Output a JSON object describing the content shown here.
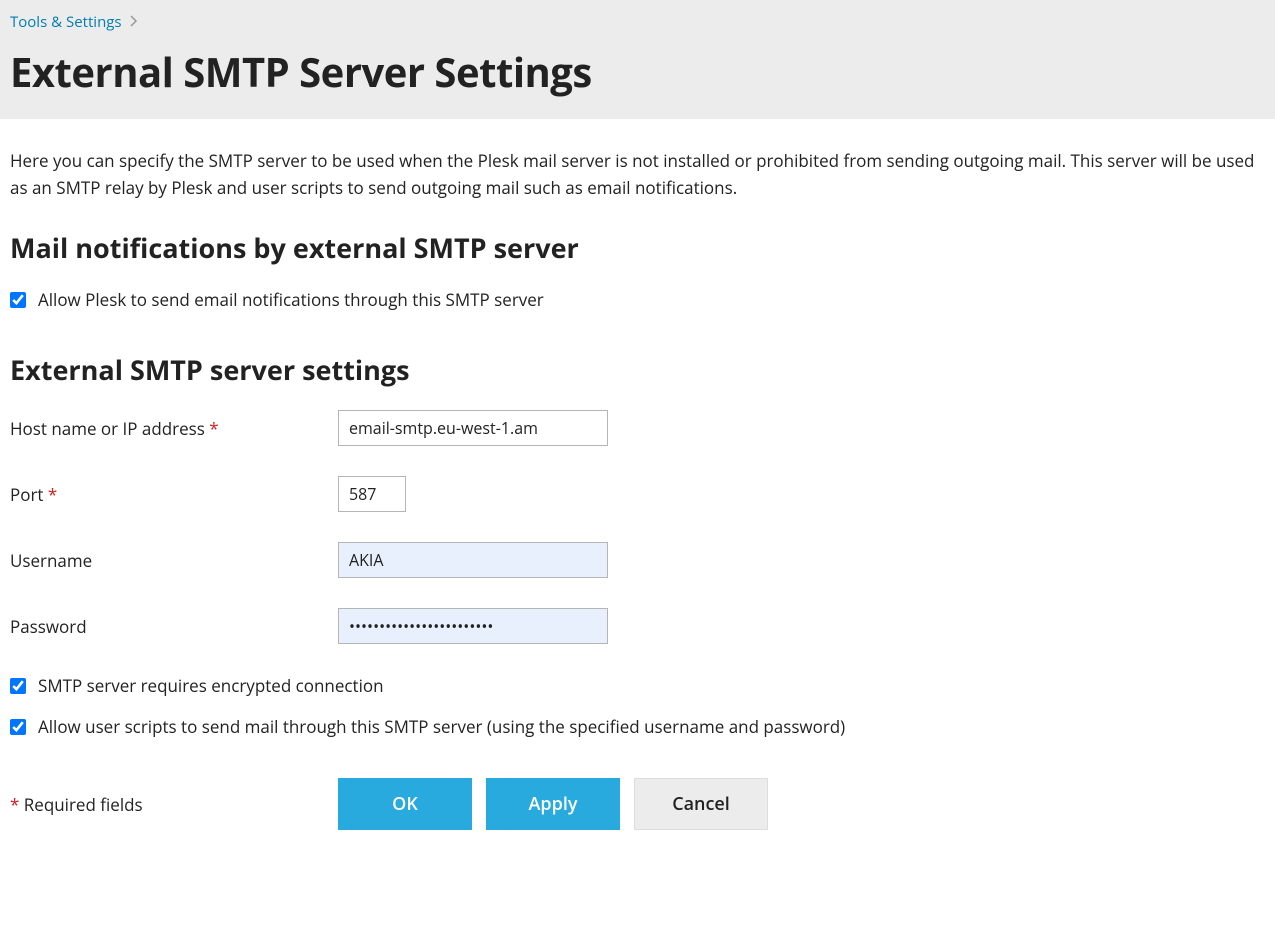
{
  "breadcrumb": {
    "link": "Tools & Settings"
  },
  "page": {
    "title": "External SMTP Server Settings",
    "description": "Here you can specify the SMTP server to be used when the Plesk mail server is not installed or prohibited from sending outgoing mail. This server will be used as an SMTP relay by Plesk and user scripts to send outgoing mail such as email notifications."
  },
  "sections": {
    "notifications": {
      "title": "Mail notifications by external SMTP server",
      "allow_label": "Allow Plesk to send email notifications through this SMTP server"
    },
    "settings": {
      "title": "External SMTP server settings",
      "host_label": "Host name or IP address",
      "host_value": "email-smtp.eu-west-1.am",
      "port_label": "Port",
      "port_value": "587",
      "username_label": "Username",
      "username_value": "AKIA",
      "password_label": "Password",
      "password_value": "••••••••••••••••••••••••",
      "encrypted_label": "SMTP server requires encrypted connection",
      "userscripts_label": "Allow user scripts to send mail through this SMTP server (using the specified username and password)"
    }
  },
  "footer": {
    "required_note": "Required fields",
    "ok": "OK",
    "apply": "Apply",
    "cancel": "Cancel"
  }
}
